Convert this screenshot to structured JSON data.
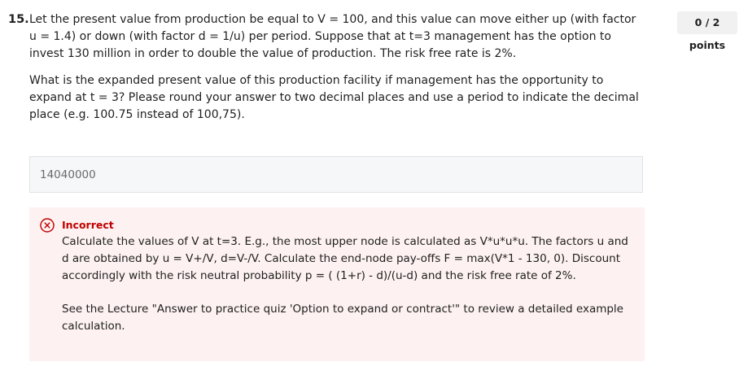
{
  "question": {
    "number": "15.",
    "paragraph1": "Let the present value from production be equal to V = 100, and this value can move either up (with factor u = 1.4) or down (with factor d = 1/u) per period. Suppose that at t=3 management has the option to invest 130 million in order to double the value of production. The risk free rate is 2%.",
    "paragraph2": "What is the expanded present value of this production facility if management has the opportunity to expand at t = 3? Please round your answer to two decimal places and use a period to indicate the decimal place (e.g. 100.75 instead of 100,75).",
    "points": "0 / 2 points"
  },
  "answer": {
    "value": "14040000"
  },
  "feedback": {
    "status": "Incorrect",
    "paragraph1": "Calculate the values of V at t=3. E.g., the most upper node is calculated as V*u*u*u. The factors u and d are obtained by u = V+/V, d=V-/V. Calculate the end-node pay-offs F = max(V*1 - 130, 0). Discount accordingly with the risk neutral probability p = ( (1+r) - d)/(u-d) and the risk free rate of 2%.",
    "paragraph2": "See the Lecture \"Answer to practice quiz 'Option to expand or contract'\" to review a detailed example calculation.",
    "icon": "x-circle-icon",
    "color": "#c00000"
  }
}
